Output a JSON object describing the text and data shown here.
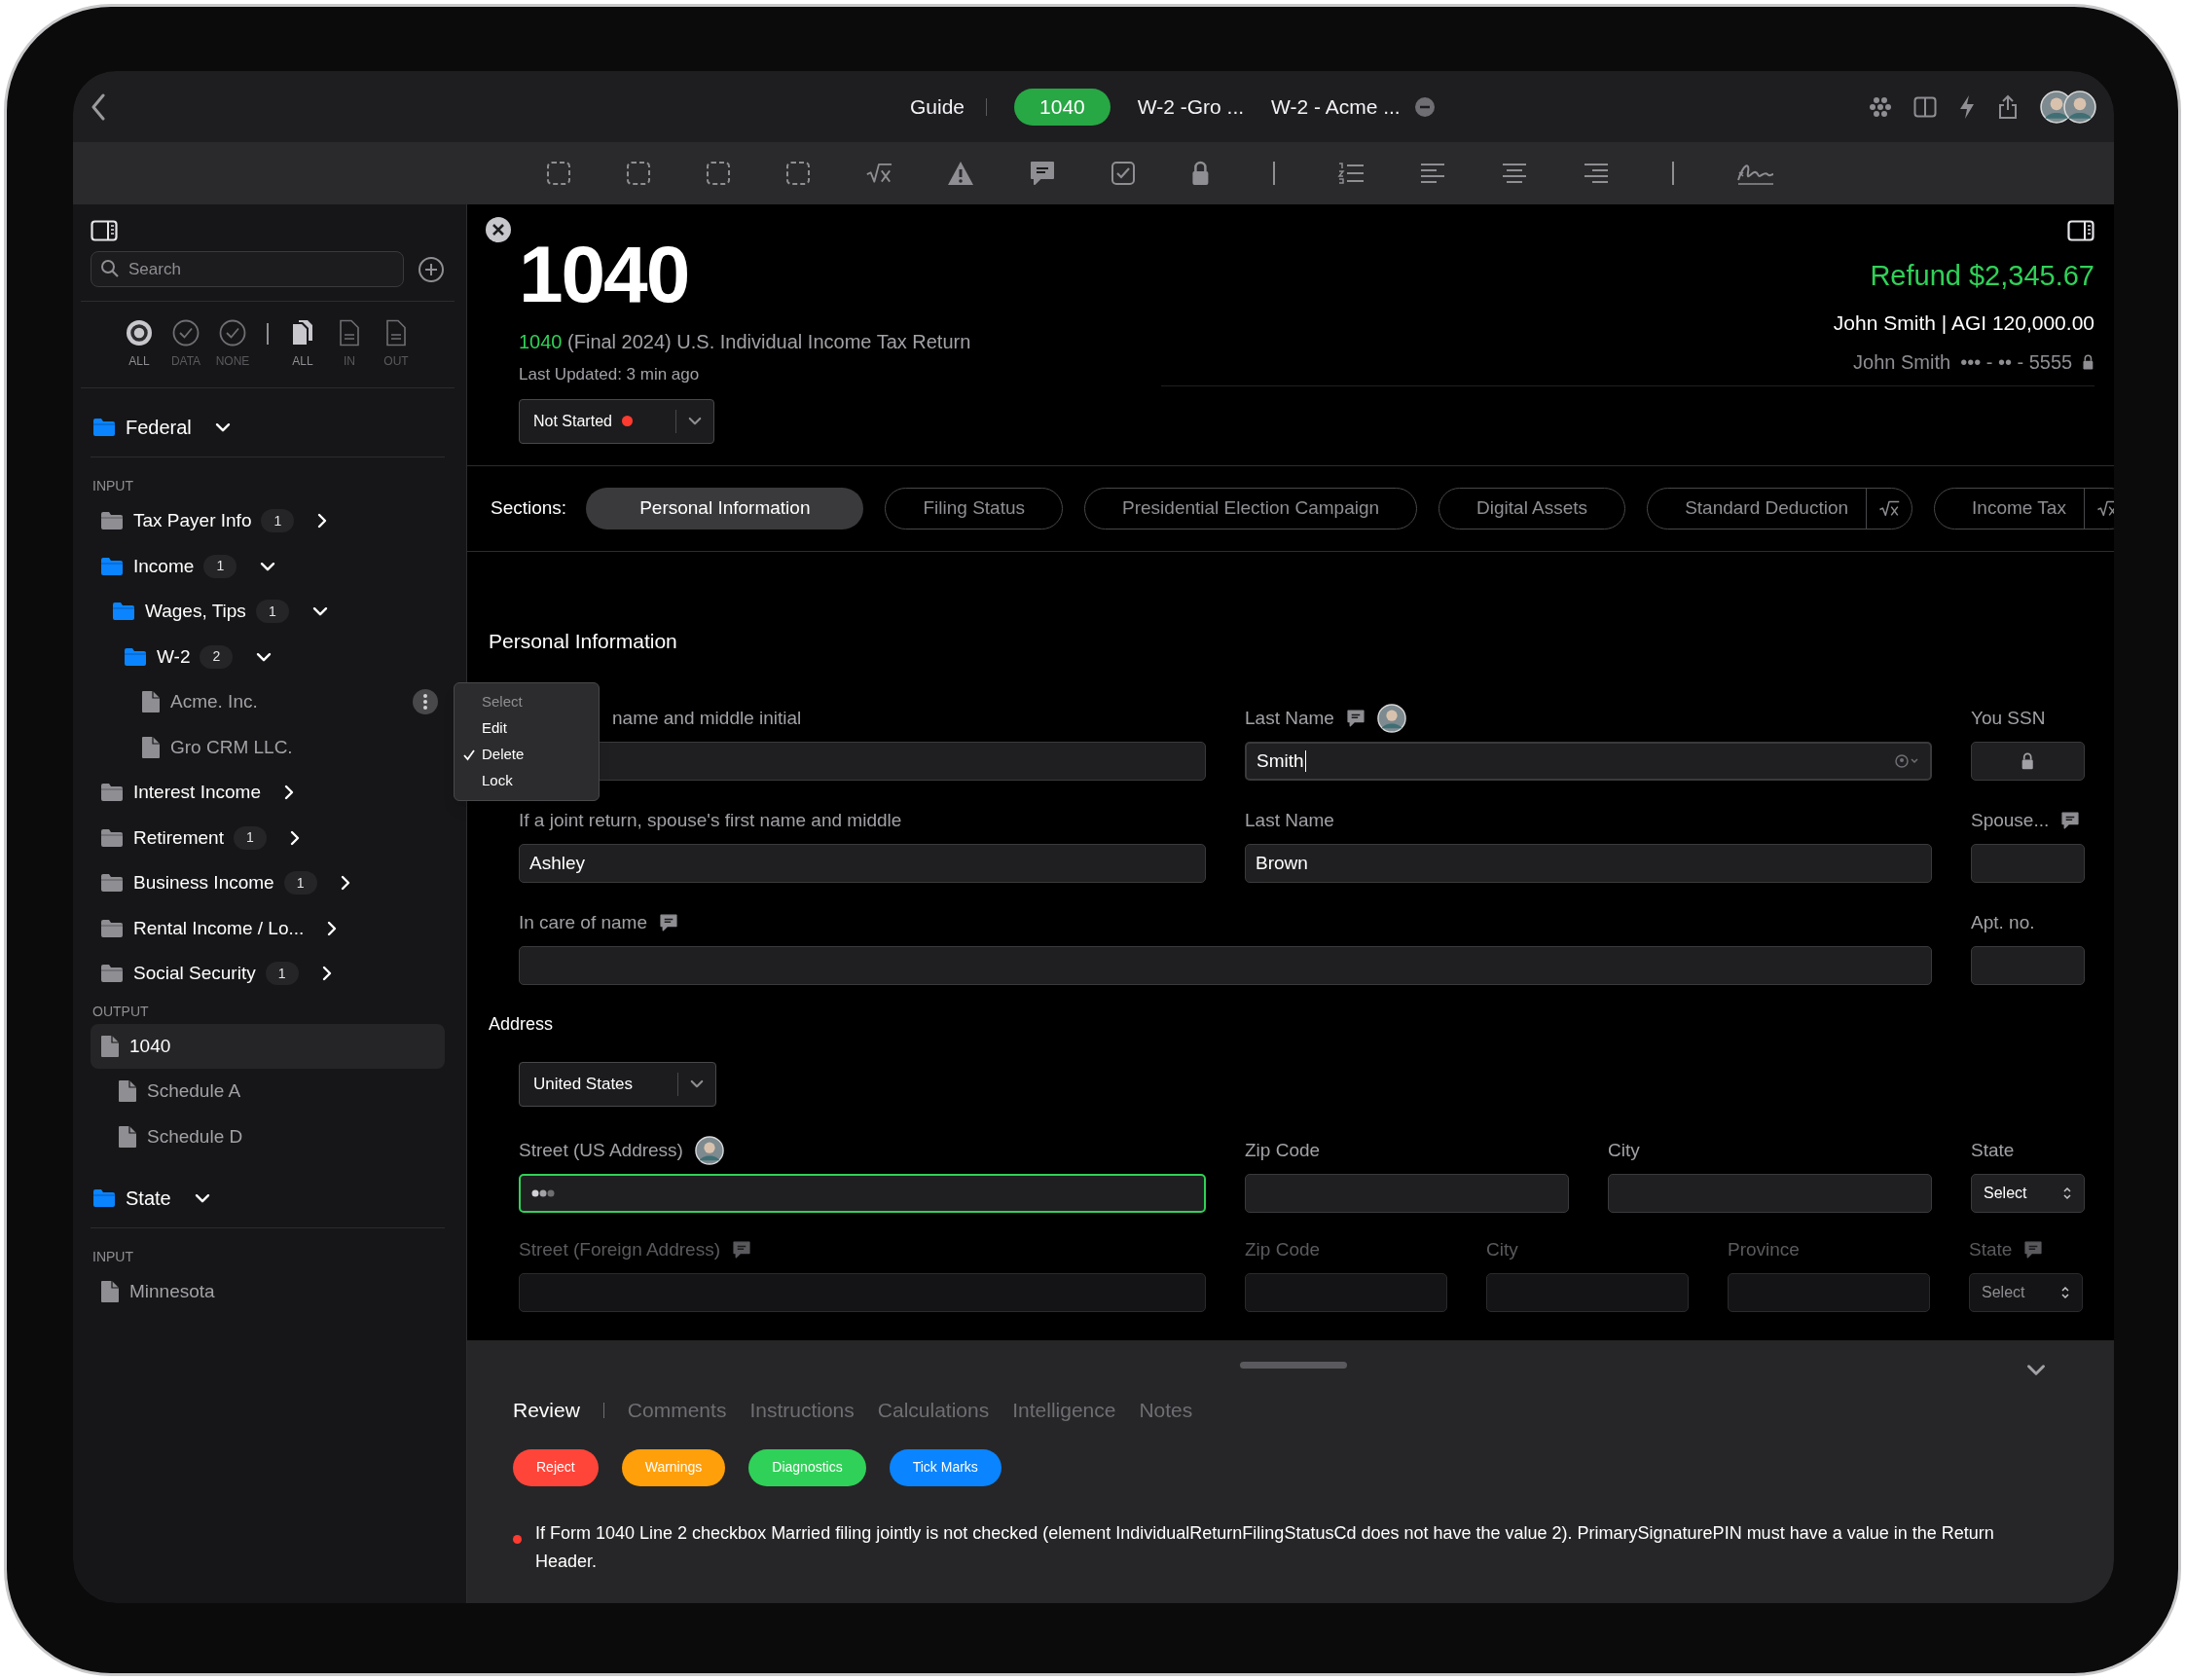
{
  "top_bar": {
    "tabs": [
      {
        "label": "Guide",
        "selected": false
      },
      {
        "label": "1040",
        "selected": true
      },
      {
        "label": "W-2 -Gro ...",
        "selected": false
      },
      {
        "label": "W-2 - Acme ...",
        "selected": false,
        "closable": true
      }
    ]
  },
  "sidebar": {
    "search": {
      "placeholder": "Search"
    },
    "status_filters": [
      {
        "label": "ALL",
        "selected": true
      },
      {
        "label": "DATA",
        "selected": false
      },
      {
        "label": "NONE",
        "selected": false
      }
    ],
    "doc_filters": [
      {
        "label": "ALL",
        "selected": true
      },
      {
        "label": "IN",
        "selected": false
      },
      {
        "label": "OUT",
        "selected": false
      }
    ],
    "groups": [
      {
        "name": "Federal",
        "expanded": true,
        "sections": [
          {
            "heading": "INPUT",
            "items": [
              {
                "kind": "folder",
                "label": "Tax Payer Info",
                "count": "1",
                "expanded": false
              },
              {
                "kind": "folder",
                "label": "Income",
                "count": "1",
                "expanded": true,
                "children": [
                  {
                    "kind": "folder",
                    "label": "Wages, Tips",
                    "count": "1",
                    "expanded": true,
                    "children": [
                      {
                        "kind": "folder",
                        "label": "W-2",
                        "count": "2",
                        "expanded": true,
                        "children": [
                          {
                            "kind": "file",
                            "label": "Acme. Inc.",
                            "selected": false,
                            "more_button": true
                          },
                          {
                            "kind": "file",
                            "label": "Gro CRM LLC.",
                            "selected": false,
                            "more_button": false
                          }
                        ]
                      }
                    ]
                  }
                ]
              },
              {
                "kind": "folder",
                "label": "Interest Income",
                "expanded": false
              },
              {
                "kind": "folder",
                "label": "Retirement",
                "count": "1",
                "expanded": false
              },
              {
                "kind": "folder",
                "label": "Business Income",
                "count": "1",
                "expanded": false
              },
              {
                "kind": "folder",
                "label": "Rental Income / Lo...",
                "expanded": false
              },
              {
                "kind": "folder",
                "label": "Social Security",
                "count": "1",
                "expanded": false
              }
            ]
          },
          {
            "heading": "OUTPUT",
            "items": [
              {
                "kind": "file",
                "label": "1040",
                "selected": true,
                "more_button": false,
                "children": [
                  {
                    "kind": "file",
                    "label": "Schedule A",
                    "selected": false,
                    "more_button": false
                  },
                  {
                    "kind": "file",
                    "label": "Schedule D",
                    "selected": false,
                    "more_button": false
                  }
                ]
              }
            ]
          }
        ]
      },
      {
        "name": "State",
        "expanded": true,
        "sections": [
          {
            "heading": "INPUT",
            "items": [
              {
                "kind": "file",
                "label": "Minnesota",
                "selected": false,
                "more_button": false
              }
            ]
          }
        ]
      }
    ]
  },
  "context_menu": {
    "items": [
      {
        "label": "Select",
        "kind": "header",
        "checked": false
      },
      {
        "label": "Edit",
        "kind": "option",
        "checked": false
      },
      {
        "label": "Delete",
        "kind": "option",
        "checked": true
      },
      {
        "label": "Lock",
        "kind": "option",
        "checked": false
      }
    ]
  },
  "header": {
    "title": "1040",
    "form_code": "1040",
    "subtitle": "(Final 2024) U.S. Individual Income Tax Return",
    "updated": "Last Updated: 3 min ago",
    "status": {
      "label": "Not Started",
      "color": "#ff3b30"
    },
    "refund": "Refund $2,345.67",
    "taxpayer": "John Smith | AGI 120,000.00",
    "ssn_name": "John Smith",
    "ssn": "••• - •• - 5555"
  },
  "sections_label": "Sections:",
  "sections": [
    {
      "label": "Personal Information",
      "selected": true,
      "formula": false
    },
    {
      "label": "Filing Status",
      "selected": false,
      "formula": false
    },
    {
      "label": "Presidential Election Campaign",
      "selected": false,
      "formula": false
    },
    {
      "label": "Digital Assets",
      "selected": false,
      "formula": false
    },
    {
      "label": "Standard Deduction",
      "selected": false,
      "formula": true
    },
    {
      "label": "Income Tax",
      "selected": false,
      "formula": true
    }
  ],
  "form": {
    "heading": "Personal Information",
    "address_heading": "Address",
    "country": "United States",
    "rows": [
      {
        "disabled": false,
        "fields": [
          {
            "kind": "text",
            "label": "name and middle initial"
          },
          {
            "kind": "text",
            "label": "Last Name",
            "comment": true,
            "avatar": true,
            "value": "Smith",
            "focused": true
          },
          {
            "kind": "locked",
            "label": "You SSN"
          }
        ]
      },
      {
        "disabled": false,
        "fields": [
          {
            "kind": "text",
            "label": "If a joint return, spouse's first name and middle",
            "value": "Ashley"
          },
          {
            "kind": "text",
            "label": "Last Name",
            "value": "Brown"
          },
          {
            "kind": "text",
            "label": "Spouse...",
            "comment": true
          }
        ]
      },
      {
        "disabled": false,
        "fields": [
          {
            "kind": "text",
            "label": "In care of name",
            "comment": true
          },
          {
            "kind": "text",
            "label": "Apt. no."
          }
        ]
      },
      {
        "disabled": false,
        "fields": [
          {
            "kind": "text",
            "label": "Street (US Address)",
            "avatar": true,
            "typing": true
          },
          {
            "kind": "text",
            "label": "Zip Code"
          },
          {
            "kind": "text",
            "label": "City"
          },
          {
            "kind": "select",
            "label": "State",
            "value": "Select"
          }
        ]
      },
      {
        "disabled": true,
        "fields": [
          {
            "kind": "text",
            "label": "Street (Foreign Address)",
            "comment": true
          },
          {
            "kind": "text",
            "label": "Zip Code"
          },
          {
            "kind": "text",
            "label": "City"
          },
          {
            "kind": "text",
            "label": "Province"
          },
          {
            "kind": "select",
            "label": "State",
            "comment": true,
            "value": "Select"
          }
        ]
      }
    ]
  },
  "bottom_panel": {
    "tabs": [
      {
        "label": "Review",
        "selected": true
      },
      {
        "label": "Comments",
        "selected": false
      },
      {
        "label": "Instructions",
        "selected": false
      },
      {
        "label": "Calculations",
        "selected": false
      },
      {
        "label": "Intelligence",
        "selected": false
      },
      {
        "label": "Notes",
        "selected": false
      }
    ],
    "filters": [
      {
        "label": "Reject",
        "color": "#ff453a"
      },
      {
        "label": "Warnings",
        "color": "#ff9f0a"
      },
      {
        "label": "Diagnostics",
        "color": "#30d158"
      },
      {
        "label": "Tick Marks",
        "color": "#0a84ff"
      }
    ],
    "messages": [
      {
        "text": "If Form 1040 Line 2 checkbox Married filing jointly is not checked (element IndividualReturnFilingStatusCd does not have the value 2). PrimarySignaturePIN must have a value in the Return Header.",
        "color": "#ff3b30"
      }
    ]
  }
}
